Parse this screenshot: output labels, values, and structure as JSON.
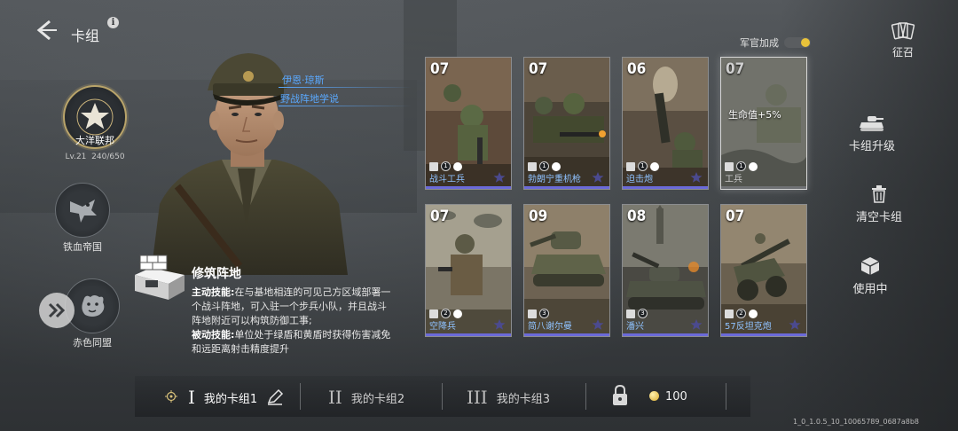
{
  "header": {
    "title": "卡组",
    "info_icon": "i"
  },
  "factions": [
    {
      "name": "大洋联邦",
      "level": "Lv.21",
      "xp": "240/650",
      "icon": "star-emblem-icon",
      "selected": true
    },
    {
      "name": "铁血帝国",
      "icon": "eagle-emblem-icon",
      "selected": false
    },
    {
      "name": "赤色同盟",
      "icon": "bear-emblem-icon",
      "selected": false
    }
  ],
  "commander": {
    "name": "伊恩·琼斯",
    "doctrine": "野战阵地学说"
  },
  "skill": {
    "title": "修筑阵地",
    "active_label": "主动技能:",
    "active_text": "在与基地相连的可见己方区域部署一个战斗阵地，可入驻一个步兵小队，并且战斗阵地附近可以构筑防御工事;",
    "passive_label": "被动技能:",
    "passive_text": "单位处于绿盾和黄盾时获得伤害减免和远距离射击精度提升"
  },
  "officer_toggle": {
    "label": "军官加成",
    "enabled": true
  },
  "cards": [
    {
      "cost": "07",
      "name": "战斗工兵",
      "level": "1",
      "locked": false
    },
    {
      "cost": "07",
      "name": "勃朗宁重机枪",
      "level": "1",
      "locked": false
    },
    {
      "cost": "06",
      "name": "迫击炮",
      "level": "1",
      "locked": false
    },
    {
      "cost": "07",
      "name": "工兵",
      "level": "1",
      "locked": true,
      "bonus": "生命值+5%"
    },
    {
      "cost": "07",
      "name": "空降兵",
      "level": "2",
      "locked": false
    },
    {
      "cost": "09",
      "name": "简八谢尔曼",
      "level": "3",
      "locked": false
    },
    {
      "cost": "08",
      "name": "潘兴",
      "level": "3",
      "locked": false
    },
    {
      "cost": "07",
      "name": "57反坦克炮",
      "level": "2",
      "locked": false
    }
  ],
  "right_menu": {
    "recruit": "征召",
    "upgrade": "卡组升级",
    "clear": "清空卡组",
    "in_use": "使用中"
  },
  "deck_tabs": [
    {
      "roman": "I",
      "label": "我的卡组1",
      "active": true
    },
    {
      "roman": "II",
      "label": "我的卡组2",
      "active": false
    },
    {
      "roman": "III",
      "label": "我的卡组3",
      "active": false
    }
  ],
  "currency": {
    "amount": "100"
  },
  "version": "1_0_1.0.5_10_10065789_0687a8b8",
  "colors": {
    "accent_blue": "#5aa9ff",
    "card_underline": "#6b6ad9",
    "toggle_on": "#e8c23a"
  }
}
